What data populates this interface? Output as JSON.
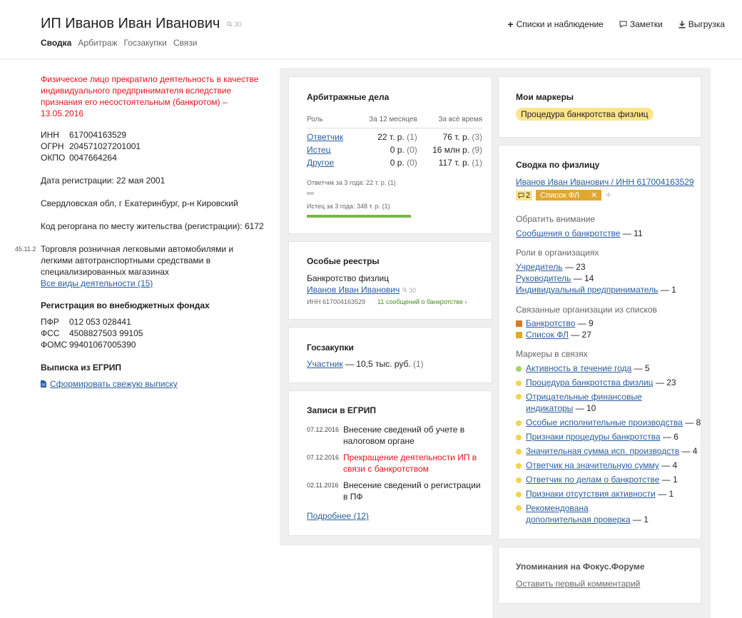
{
  "header": {
    "title": "ИП Иванов Иван Иванович",
    "views": "30",
    "tabs": [
      "Сводка",
      "Арбитраж",
      "Госзакупки",
      "Связи"
    ],
    "actions": [
      "Списки и наблюдение",
      "Заметки",
      "Выгрузка"
    ]
  },
  "left": {
    "status": "Физическое лицо прекратило деятельность в качестве индивидуального предпринимателя вследствие признания его несостоятельным (банкротом) – 13.05.2016",
    "ids": [
      {
        "k": "ИНН",
        "v": "617004163529"
      },
      {
        "k": "ОГРН",
        "v": "204571027201001"
      },
      {
        "k": "ОКПО",
        "v": "0047664264"
      }
    ],
    "reg_date": "Дата регистрации: 22 мая 2001",
    "address": "Свердловская обл, г Екатеринбург, р-н Кировский",
    "regorgan": "Код регоргана по месту жительства (регистрации): 6172",
    "okved_code": "45.11.2",
    "okved_text": "Торговля розничная легковыми автомобилями и легкими автотранспортными средствами в специализированных магазинах",
    "okved_link": "Все виды деятельности (15)",
    "funds_title": "Регистрация во внебюджетных фондах",
    "funds": [
      {
        "k": "ПФР",
        "v": "012 053 028441"
      },
      {
        "k": "ФСС",
        "v": "4508827503 99105"
      },
      {
        "k": "ФОМС",
        "v": "99401067005390"
      }
    ],
    "egrip_title": "Выписка из ЕГРИП",
    "egrip_link": "Сформировать свежую выписку"
  },
  "arbitr": {
    "title": "Арбитражные дела",
    "cols": [
      "Роль",
      "За 12 месяцев",
      "За всё время"
    ],
    "rows": [
      {
        "role": "Ответчик",
        "m12": "22 т. р.",
        "m12c": "(1)",
        "all": "76 т. р.",
        "allc": "(3)"
      },
      {
        "role": "Истец",
        "m12": "0 р.",
        "m12c": "(0)",
        "all": "16 млн р.",
        "allc": "(9)"
      },
      {
        "role": "Другое",
        "m12": "0 р.",
        "m12c": "(0)",
        "all": "117 т. р.",
        "allc": "(1)"
      }
    ],
    "bar1_label": "Ответчик за 3 года: 22 т. р. (1)",
    "bar2_label": "Истец за 3 года: 348 т. р. (1)"
  },
  "registries": {
    "title": "Особые реестры",
    "sub": "Банкротство физлиц",
    "name": "Иванов Иван Иванович",
    "views": "30",
    "inn": "ИНН 617004163529",
    "messages": "11 сообщений о банкротстве ›"
  },
  "goszakupki": {
    "title": "Госзакупки",
    "link": "Участник",
    "text": "— 10,5 тыс. руб.",
    "count": "(1)"
  },
  "egrip": {
    "title": "Записи в ЕГРИП",
    "items": [
      {
        "date": "07.12.2016",
        "text": "Внесение сведений об учете в налоговом органе",
        "red": false
      },
      {
        "date": "07.12.2016",
        "text": "Прекращение деятельности ИП в связи с банкротством",
        "red": true
      },
      {
        "date": "02.11.2016",
        "text": "Внесение сведений о регистрации в ПФ",
        "red": false
      }
    ],
    "more": "Подробнее (12)"
  },
  "markers": {
    "title": "Мои маркеры",
    "tag": "Процедура банкротства физлиц"
  },
  "summary": {
    "title": "Сводка по физлицу",
    "person_link": "Иванов Иван Иванович / ИНН 617004163529",
    "comment_count": "2",
    "list_tag": "Список ФЛ",
    "attention_title": "Обратить внимание",
    "attention": [
      {
        "link": "Сообщения о банкротстве",
        "count": "— 11"
      }
    ],
    "roles_title": "Роли в организациях",
    "roles": [
      {
        "link": "Учредитель",
        "count": "— 23"
      },
      {
        "link": "Руководитель",
        "count": "— 14"
      },
      {
        "link": "Индивидуальный предприниматель",
        "count": "— 1"
      }
    ],
    "lists_title": "Связанные организации из списков",
    "lists": [
      {
        "link": "Банкротство",
        "count": "— 9",
        "color": "#d9792b"
      },
      {
        "link": "Список ФЛ",
        "count": "— 27",
        "color": "#e0a82e"
      }
    ],
    "links_title": "Маркеры в связях",
    "links": [
      {
        "link": "Активность в течение года",
        "count": "— 5",
        "color": "#a5d36b"
      },
      {
        "link": "Процедура банкротства физлиц",
        "count": "— 23",
        "color": "#f5d34f"
      },
      {
        "link": "Отрицательные финансовые индикаторы",
        "count": "— 10",
        "color": "#f5d34f"
      },
      {
        "link": "Особые исполнительные производства",
        "count": "— 8",
        "color": "#f5d34f"
      },
      {
        "link": "Признаки процедуры банкротства",
        "count": "— 6",
        "color": "#f5d34f"
      },
      {
        "link": "Значительная сумма исп. производств",
        "count": "— 4",
        "color": "#f5d34f"
      },
      {
        "link": "Ответчик на значительную сумму",
        "count": "— 4",
        "color": "#f5d34f"
      },
      {
        "link": "Ответчик по делам о банкротстве",
        "count": "— 1",
        "color": "#f5d34f"
      },
      {
        "link": "Признаки отсутствия активности",
        "count": "— 1",
        "color": "#f5d34f"
      },
      {
        "link": "Рекомендована дополнительная проверка",
        "count": "— 1",
        "color": "#f5d34f"
      }
    ]
  },
  "forum": {
    "title": "Упоминания на Фокус.Форуме",
    "link": "Оставить первый комментарий"
  }
}
